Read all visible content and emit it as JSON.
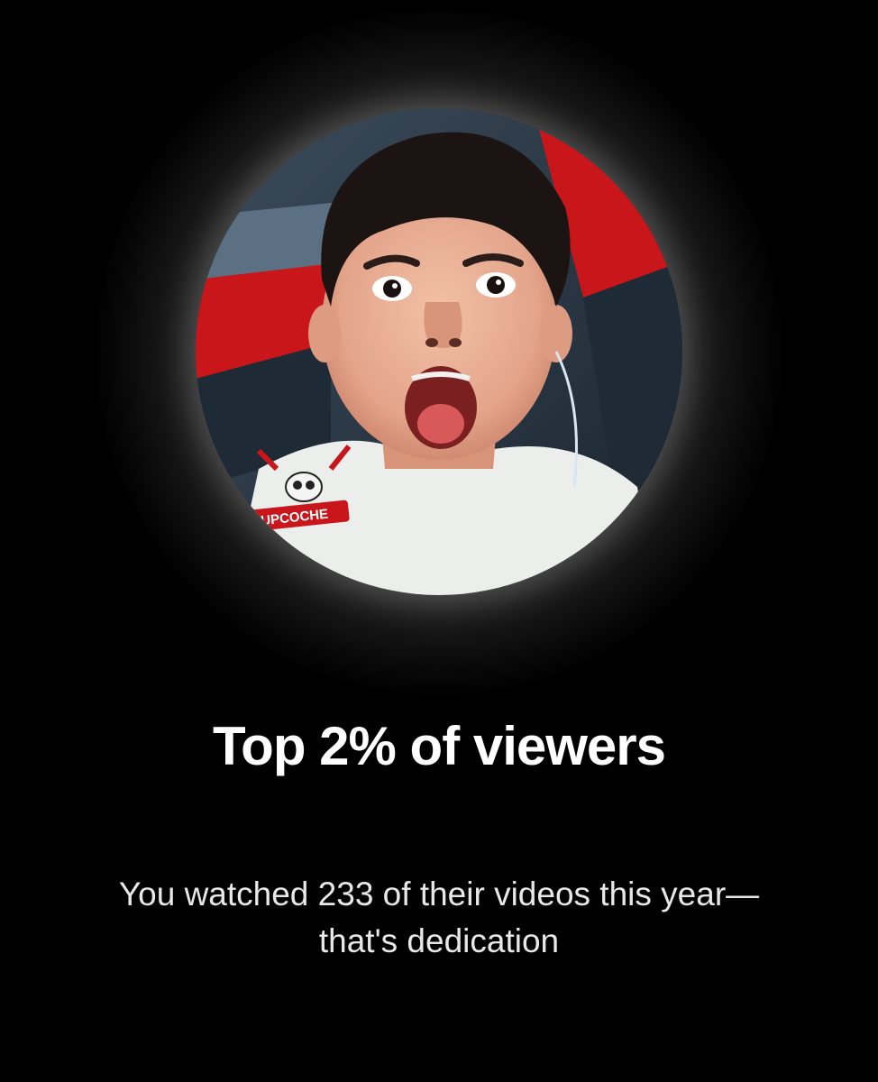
{
  "headline": "Top 2% of viewers",
  "subtext": "You watched 233 of their videos this year—that's dedication",
  "avatar": {
    "shirt_logo_text": "UPCOCHE"
  },
  "colors": {
    "background": "#000000",
    "headline": "#ffffff",
    "subtext": "#e8e8e8",
    "chair_red": "#c8161b",
    "chair_dark": "#1e2a35"
  }
}
